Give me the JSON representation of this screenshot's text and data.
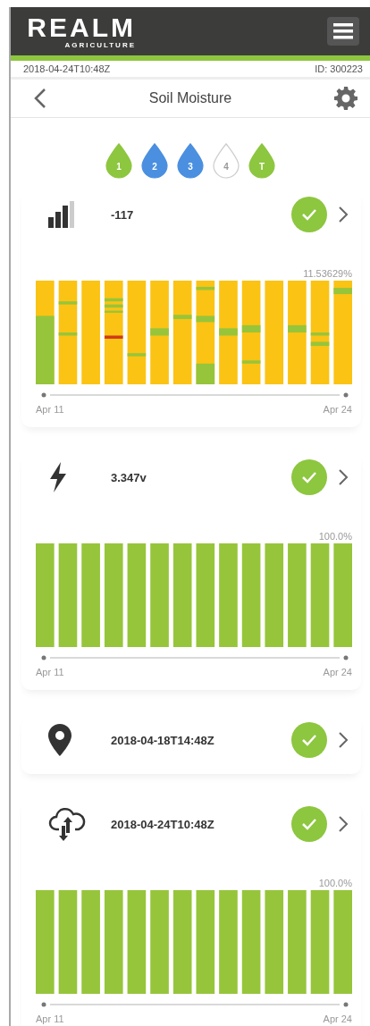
{
  "header": {
    "logo": {
      "name": "REALM",
      "tagline": "AGRICULTURE"
    }
  },
  "info_bar": {
    "timestamp": "2018-04-24T10:48Z",
    "device_id": "ID: 300223"
  },
  "nav": {
    "title": "Soil Moisture"
  },
  "sensors": [
    {
      "label": "1",
      "color": "#8dc63f"
    },
    {
      "label": "2",
      "color": "#4a8fe0"
    },
    {
      "label": "3",
      "color": "#4a8fe0"
    },
    {
      "label": "4",
      "color": "#ffffff"
    },
    {
      "label": "T",
      "color": "#8dc63f"
    }
  ],
  "cards": [
    {
      "kind": "signal",
      "value": "-117",
      "ok": true,
      "history": {
        "kind": "mixed",
        "max_label": "11.53629%",
        "start_label": "Apr 11",
        "end_label": "Apr 24"
      }
    },
    {
      "kind": "battery",
      "value": "3.347v",
      "ok": true,
      "history": {
        "kind": "full",
        "max_label": "100.0%",
        "start_label": "Apr 11",
        "end_label": "Apr 24"
      }
    },
    {
      "kind": "location",
      "value": "2018-04-18T14:48Z",
      "ok": true
    },
    {
      "kind": "sync",
      "value": "2018-04-24T10:48Z",
      "ok": true,
      "history": {
        "kind": "full",
        "max_label": "100.0%",
        "start_label": "Apr 11",
        "end_label": "Apr 24"
      }
    }
  ]
}
